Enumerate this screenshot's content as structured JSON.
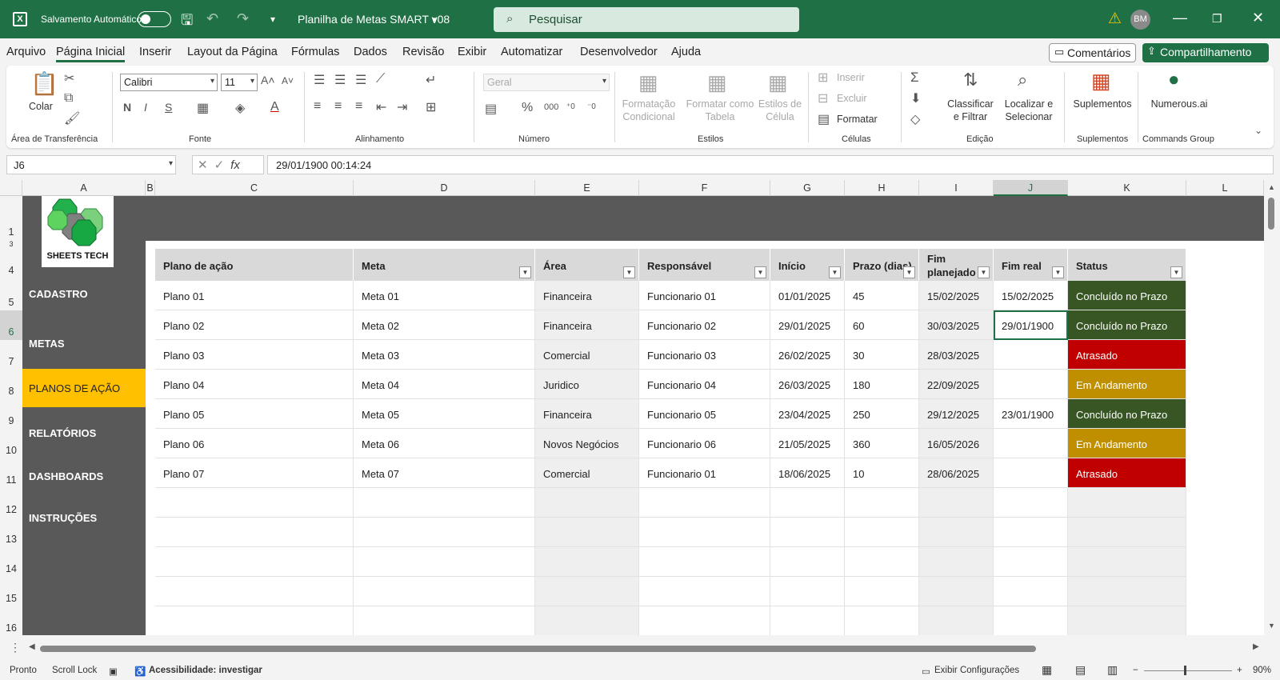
{
  "titlebar": {
    "app_icon": "excel-icon",
    "autosave_label": "Salvamento Automático",
    "file_name": "Planilha de Metas SMART v08",
    "search_placeholder": "Pesquisar",
    "user_initials": "BM"
  },
  "menu": {
    "tabs": [
      "Arquivo",
      "Página Inicial",
      "Inserir",
      "Layout da Página",
      "Fórmulas",
      "Dados",
      "Revisão",
      "Exibir",
      "Automatizar",
      "Desenvolvedor",
      "Ajuda"
    ],
    "active_tab": "Página Inicial",
    "comments": "Comentários",
    "share": "Compartilhamento"
  },
  "ribbon": {
    "paste": "Colar",
    "clipboard_label": "Área de Transferência",
    "font_name": "Calibri",
    "font_size": "11",
    "font_label": "Fonte",
    "alignment_label": "Alinhamento",
    "number_format": "Geral",
    "number_label": "Número",
    "cond_format": "Formatação Condicional",
    "format_table": "Formatar como Tabela",
    "cell_styles": "Estilos de Célula",
    "styles_label": "Estilos",
    "insert": "Inserir",
    "delete": "Excluir",
    "format": "Formatar",
    "cells_label": "Células",
    "sort_filter": "Classificar e Filtrar",
    "find_select": "Localizar e Selecionar",
    "editing_label": "Edição",
    "addins": "Suplementos",
    "addins_label": "Suplementos",
    "numerous": "Numerous.ai",
    "commands_label": "Commands Group"
  },
  "formula_bar": {
    "name_box": "J6",
    "fx": "fx",
    "content": "29/01/1900  00:14:24"
  },
  "columns": [
    "A",
    "B",
    "C",
    "D",
    "E",
    "F",
    "G",
    "H",
    "I",
    "J",
    "K",
    "L"
  ],
  "selected_column": "J",
  "rows": [
    "1",
    "3",
    "4",
    "5",
    "6",
    "7",
    "8",
    "9",
    "10",
    "11",
    "12",
    "13",
    "14",
    "15",
    "16"
  ],
  "selected_row": "6",
  "sidebar": {
    "brand": "SHEETS TECH",
    "items": [
      "CADASTRO",
      "METAS",
      "PLANOS DE AÇÃO",
      "RELATÓRIOS",
      "DASHBOARDS",
      "INSTRUÇÕES"
    ],
    "active": "PLANOS DE AÇÃO"
  },
  "table": {
    "headers": [
      "Plano de ação",
      "Meta",
      "Área",
      "Responsável",
      "Início",
      "Prazo (dias)",
      "Fim planejado",
      "Fim real",
      "Status"
    ],
    "rows": [
      [
        "Plano 01",
        "Meta 01",
        "Financeira",
        "Funcionario 01",
        "01/01/2025",
        "45",
        "15/02/2025",
        "15/02/2025",
        "Concluído no Prazo"
      ],
      [
        "Plano 02",
        "Meta 02",
        "Financeira",
        "Funcionario 02",
        "29/01/2025",
        "60",
        "30/03/2025",
        "29/01/1900",
        "Concluído no Prazo"
      ],
      [
        "Plano 03",
        "Meta 03",
        "Comercial",
        "Funcionario 03",
        "26/02/2025",
        "30",
        "28/03/2025",
        "",
        "Atrasado"
      ],
      [
        "Plano 04",
        "Meta 04",
        "Juridico",
        "Funcionario 04",
        "26/03/2025",
        "180",
        "22/09/2025",
        "",
        "Em Andamento"
      ],
      [
        "Plano 05",
        "Meta 05",
        "Financeira",
        "Funcionario 05",
        "23/04/2025",
        "250",
        "29/12/2025",
        "23/01/1900",
        "Concluído no Prazo"
      ],
      [
        "Plano 06",
        "Meta 06",
        "Novos Negócios",
        "Funcionario 06",
        "21/05/2025",
        "360",
        "16/05/2026",
        "",
        "Em Andamento"
      ],
      [
        "Plano 07",
        "Meta 07",
        "Comercial",
        "Funcionario 01",
        "18/06/2025",
        "10",
        "28/06/2025",
        "",
        "Atrasado"
      ]
    ],
    "status_colors": {
      "Concluído no Prazo": "#375623",
      "Atrasado": "#c00000",
      "Em Andamento": "#bf8f00"
    }
  },
  "statusbar": {
    "ready": "Pronto",
    "scroll_lock": "Scroll Lock",
    "accessibility": "Acessibilidade: investigar",
    "display_settings": "Exibir Configurações",
    "zoom": "90%"
  },
  "colors": {
    "accent": "#1f7145",
    "sidebar": "#595959",
    "nav_active": "#ffc000"
  }
}
